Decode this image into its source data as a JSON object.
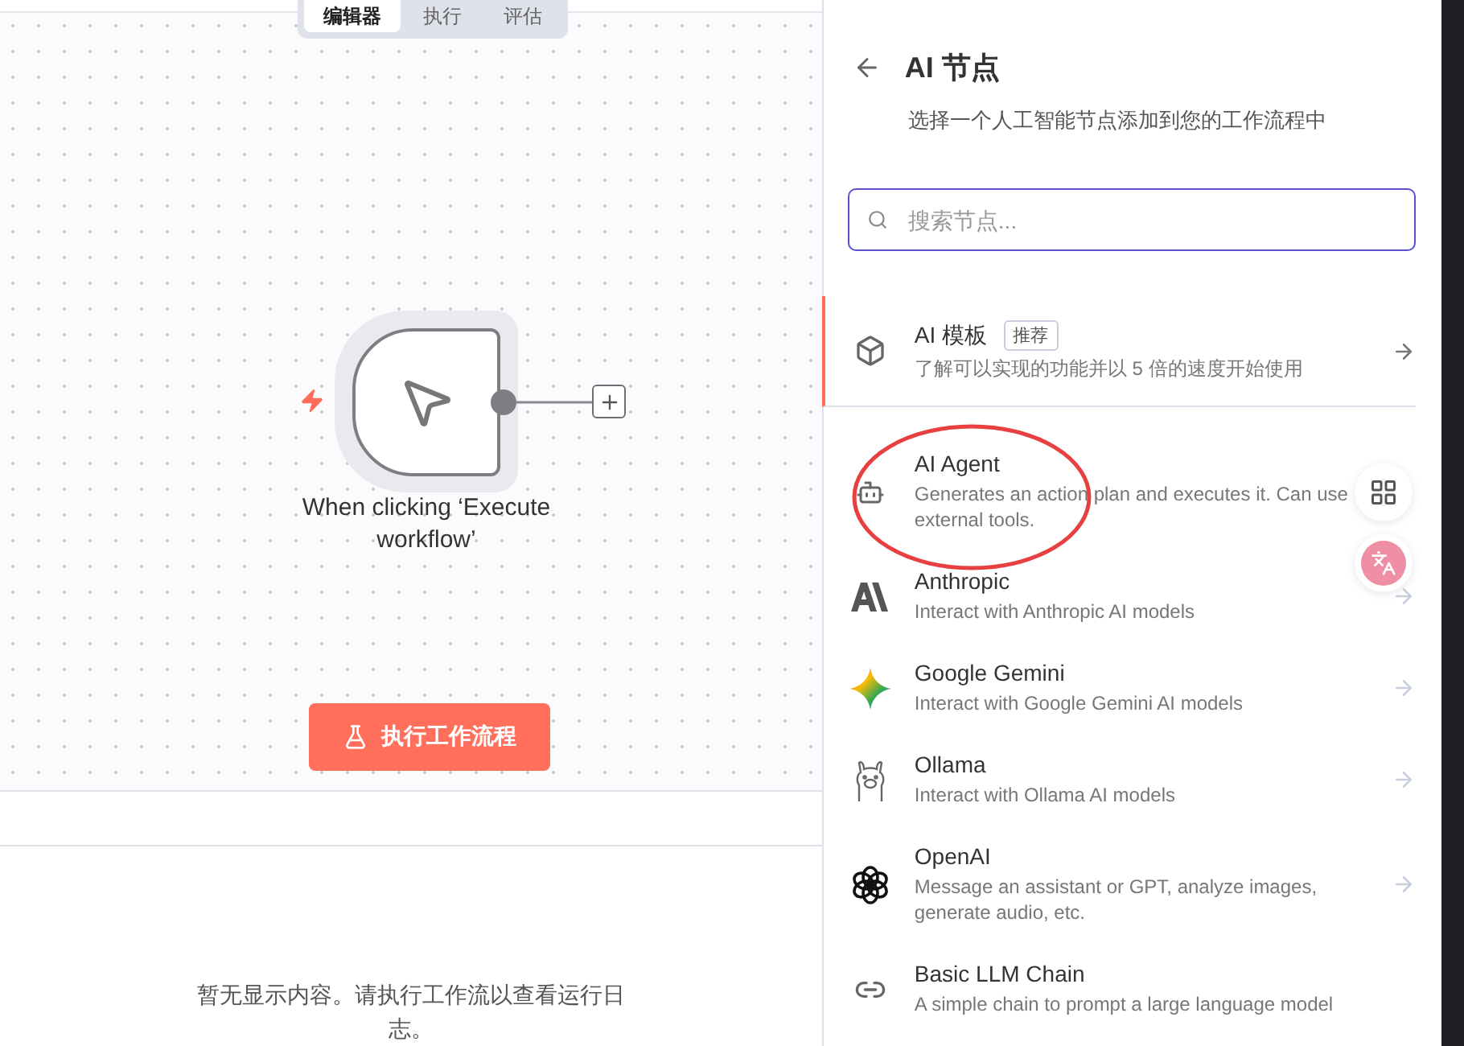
{
  "canvas_tabs": [
    {
      "label": "编辑器",
      "selected": true
    },
    {
      "label": "执行",
      "selected": false
    },
    {
      "label": "评估",
      "selected": false
    }
  ],
  "trigger_node": {
    "label": "When clicking ‘Execute workflow’"
  },
  "execute_button": {
    "label": "执行工作流程"
  },
  "logs": {
    "empty_message": "暂无显示内容。请执行工作流以查看运行日志。"
  },
  "panel": {
    "title": "AI 节点",
    "subtitle": "选择一个人工智能节点添加到您的工作流程中",
    "search": {
      "placeholder": "搜索节点..."
    },
    "items": [
      {
        "kind": "templates",
        "title": "AI 模板",
        "badge": "推荐",
        "description": "了解可以实现的功能并以 5 倍的速度开始使用",
        "selected": true,
        "arrow": true
      },
      {
        "kind": "agent",
        "title": "AI Agent",
        "description": "Generates an action plan and executes it. Can use external tools.",
        "selected": false,
        "arrow": false
      },
      {
        "kind": "anthropic",
        "title": "Anthropic",
        "description": "Interact with Anthropic AI models",
        "selected": false,
        "arrow": true
      },
      {
        "kind": "gemini",
        "title": "Google Gemini",
        "description": "Interact with Google Gemini AI models",
        "selected": false,
        "arrow": true
      },
      {
        "kind": "ollama",
        "title": "Ollama",
        "description": "Interact with Ollama AI models",
        "selected": false,
        "arrow": true
      },
      {
        "kind": "openai",
        "title": "OpenAI",
        "description": "Message an assistant or GPT, analyze images, generate audio, etc.",
        "selected": false,
        "arrow": true
      },
      {
        "kind": "chain",
        "title": "Basic LLM Chain",
        "description": "A simple chain to prompt a large language model",
        "selected": false,
        "arrow": false
      }
    ]
  }
}
